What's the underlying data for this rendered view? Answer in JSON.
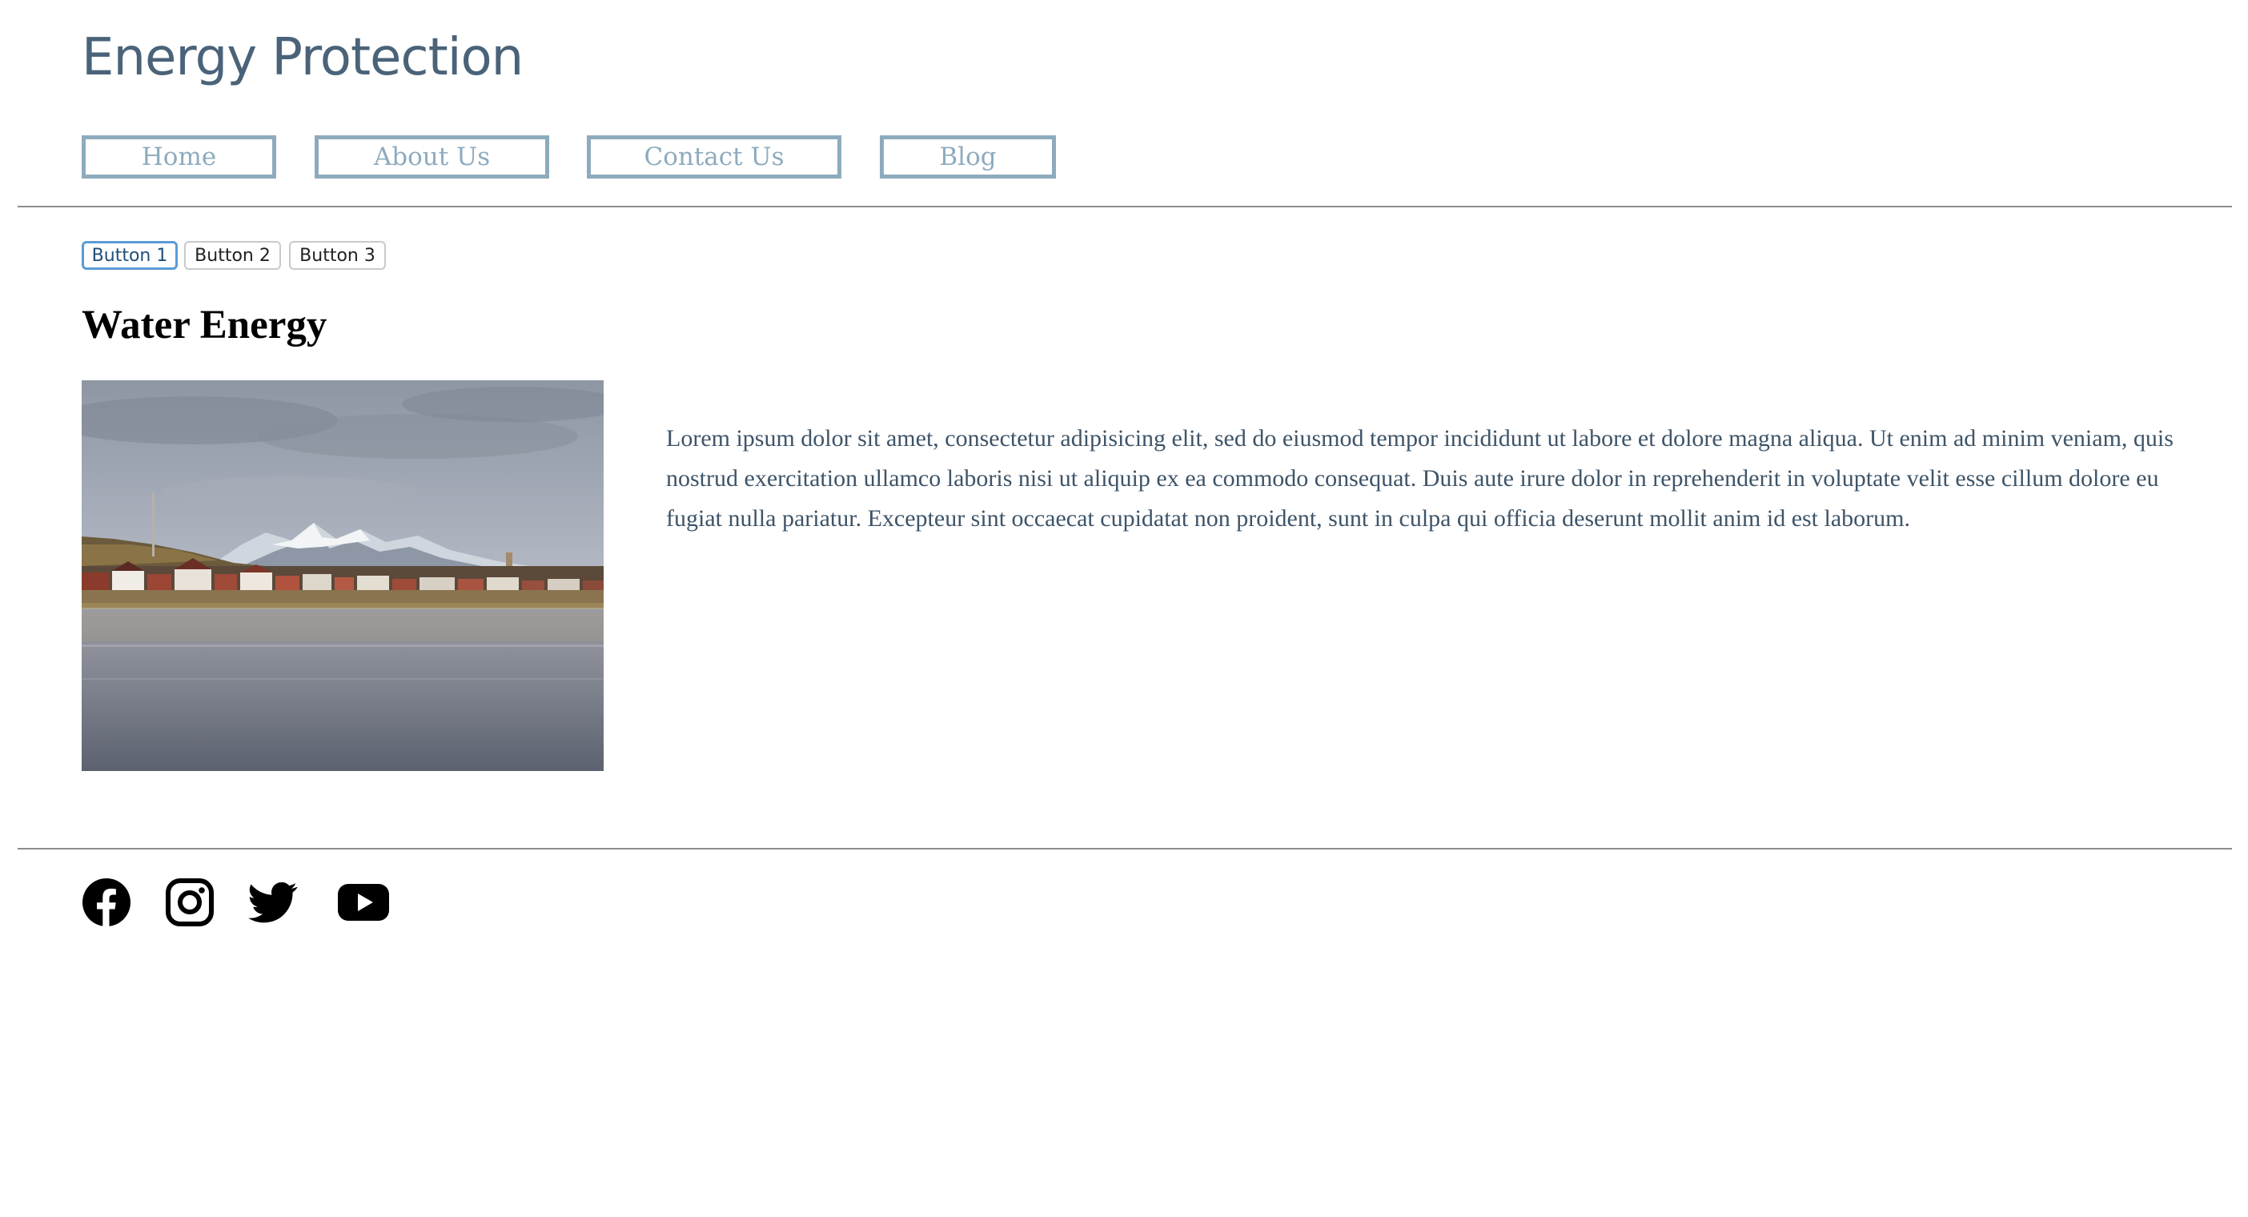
{
  "header": {
    "site_title": "Energy Protection"
  },
  "nav": {
    "items": [
      {
        "label": "Home"
      },
      {
        "label": "About Us"
      },
      {
        "label": "Contact Us"
      },
      {
        "label": "Blog"
      }
    ]
  },
  "button_group": {
    "buttons": [
      {
        "label": "Button 1",
        "active": true
      },
      {
        "label": "Button 2",
        "active": false
      },
      {
        "label": "Button 3",
        "active": false
      }
    ]
  },
  "content": {
    "title": "Water Energy",
    "image_icon": "lake-town-mountains-photo",
    "paragraph": "Lorem ipsum dolor sit amet, consectetur adipisicing elit, sed do eiusmod tempor incididunt ut labore et dolore magna aliqua. Ut enim ad minim veniam, quis nostrud exercitation ullamco laboris nisi ut aliquip ex ea commodo consequat. Duis aute irure dolor in reprehenderit in voluptate velit esse cillum dolore eu fugiat nulla pariatur. Excepteur sint occaecat cupidatat non proident, sunt in culpa qui officia deserunt mollit anim id est laborum."
  },
  "footer": {
    "social_icons": [
      "facebook-icon",
      "instagram-icon",
      "twitter-icon",
      "youtube-icon"
    ]
  },
  "colors": {
    "title": "#4a6379",
    "nav_border": "#8eabbe",
    "body_text": "#3e5468",
    "active_button_border": "#5b9bd5",
    "divider": "#8c8c8c"
  }
}
